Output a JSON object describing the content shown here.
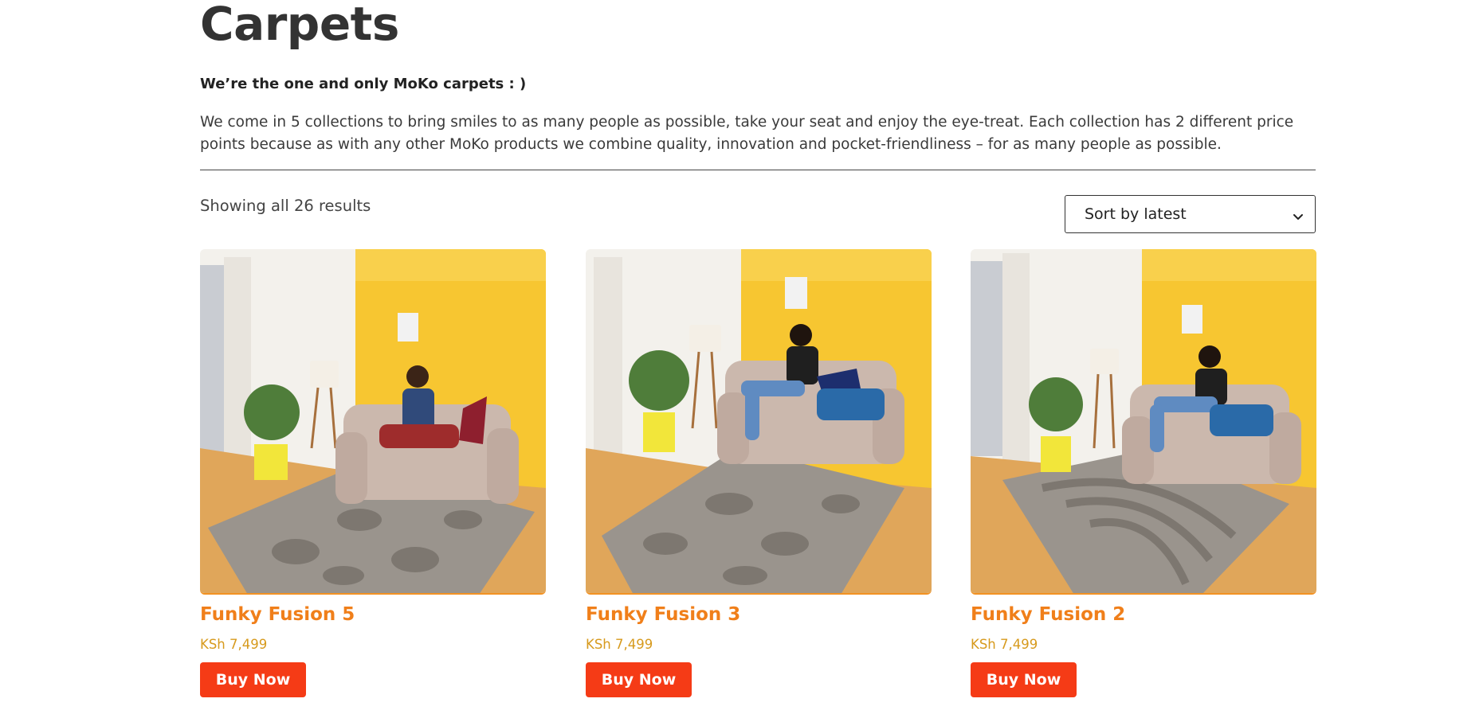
{
  "page": {
    "title": "Carpets",
    "tagline": "We’re the one and only MoKo carpets : )",
    "description": "We come in 5 collections to bring smiles to as many people as possible, take your seat and enjoy the eye-treat. Each collection has 2 different price points because as with any other MoKo products we combine quality, innovation and pocket-friendliness – for as many people as possible."
  },
  "toolbar": {
    "result_count": "Showing all 26 results",
    "sort": {
      "selected": "Sort by latest",
      "icon": "chevron-down-icon"
    }
  },
  "products": [
    {
      "name": "Funky Fusion 5",
      "price": "KSh 7,499",
      "button": "Buy Now"
    },
    {
      "name": "Funky Fusion 3",
      "price": "KSh 7,499",
      "button": "Buy Now"
    },
    {
      "name": "Funky Fusion 2",
      "price": "KSh 7,499",
      "button": "Buy Now"
    }
  ],
  "colors": {
    "accent_orange": "#f07f1a",
    "price_gold": "#d79a1d",
    "buy_button_red": "#f53b16",
    "wall_yellow": "#f7c631",
    "floor_wood": "#e0a65a",
    "carpet_grey": "#9a948d"
  }
}
